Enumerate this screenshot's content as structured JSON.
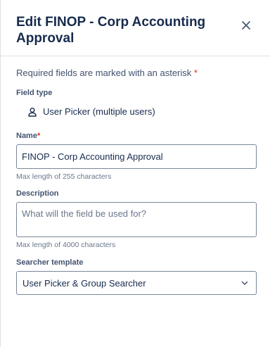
{
  "header": {
    "title": "Edit FINOP - Corp Accounting Approval",
    "close_icon": "close-icon"
  },
  "form": {
    "required_note": "Required fields are marked with an asterisk",
    "required_marker": "*",
    "field_type": {
      "label": "Field type",
      "icon": "user-icon",
      "value": "User Picker (multiple users)"
    },
    "name": {
      "label": "Name",
      "required_marker": "*",
      "value": "FINOP - Corp Accounting Approval",
      "hint": "Max length of 255 characters"
    },
    "description": {
      "label": "Description",
      "placeholder": "What will the field be used for?",
      "value": "",
      "hint": "Max length of 4000 characters"
    },
    "searcher_template": {
      "label": "Searcher template",
      "selected": "User Picker & Group Searcher",
      "icon": "chevron-down-icon"
    }
  },
  "colors": {
    "text": "#172b4d",
    "muted": "#42526e",
    "required": "#de350b",
    "border": "#7a869a"
  }
}
